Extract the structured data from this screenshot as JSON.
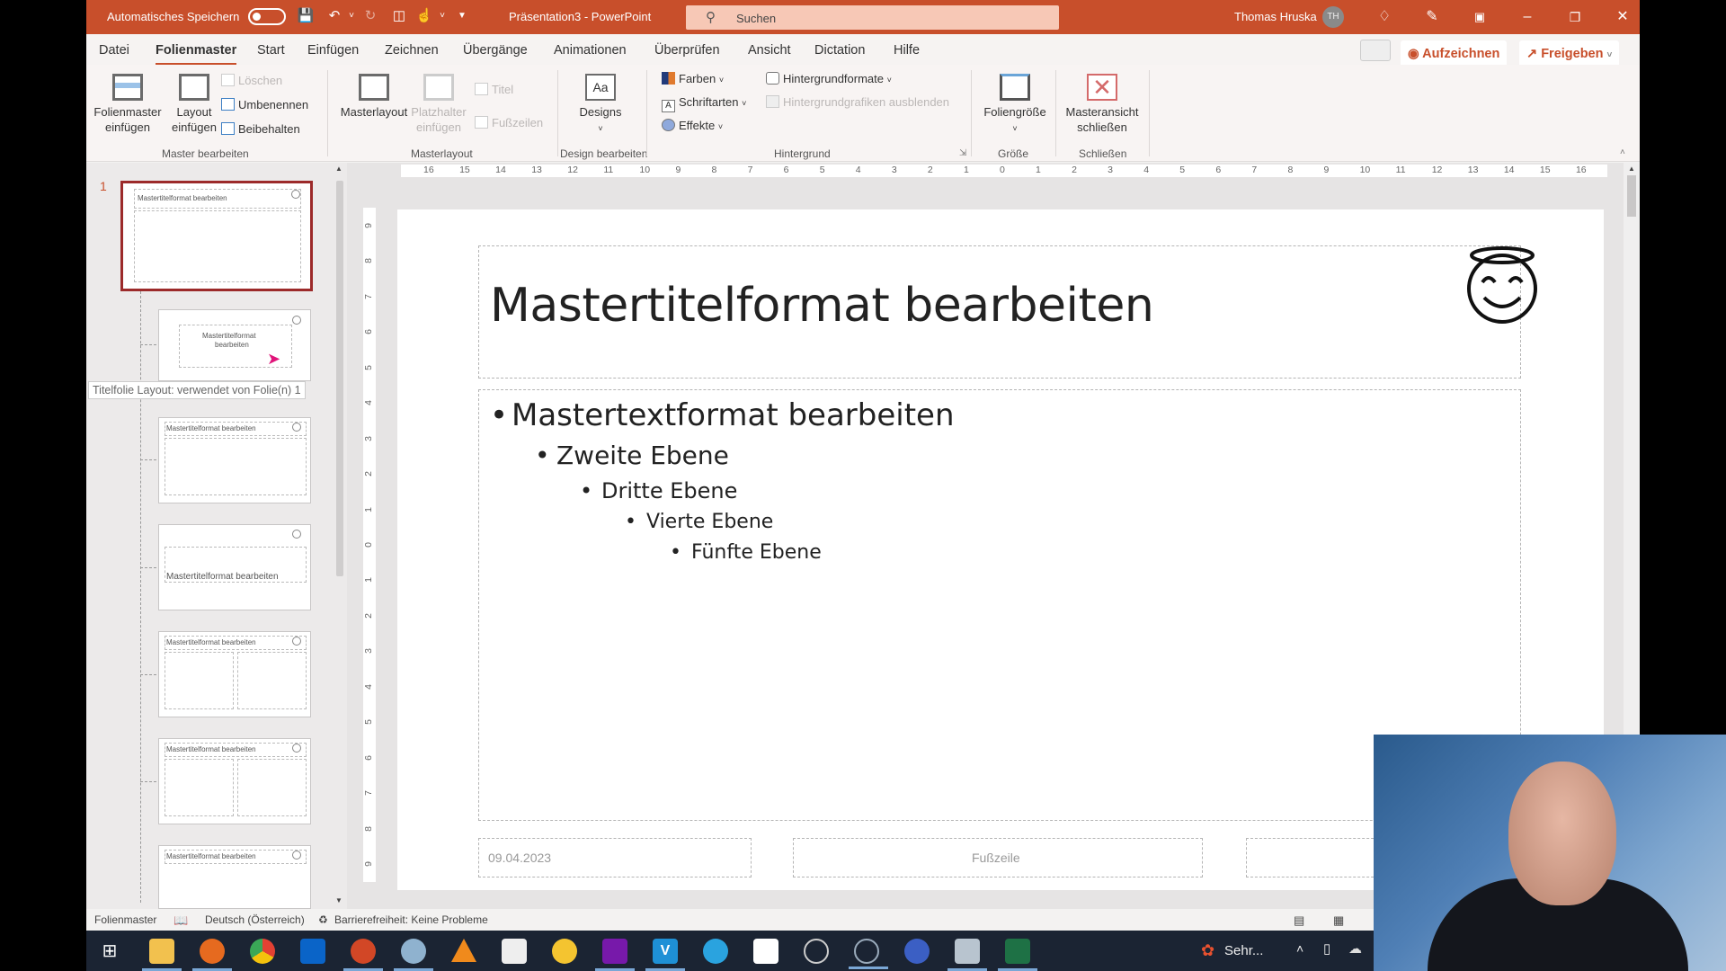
{
  "titlebar": {
    "autosave_label": "Automatisches Speichern",
    "autosave_state": "off",
    "doc_title": "Präsentation3  -  PowerPoint",
    "search_placeholder": "Suchen",
    "user_name": "Thomas Hruska",
    "user_initials": "TH",
    "icons": [
      "save-icon",
      "undo-icon",
      "redo-icon",
      "present-icon",
      "touch-mode-icon",
      "customize-qat-icon",
      "diamond-icon",
      "pen-icon",
      "ribbon-display-icon",
      "minimize-icon",
      "restore-icon",
      "close-icon"
    ]
  },
  "menu": {
    "tabs": [
      "Datei",
      "Folienmaster",
      "Start",
      "Einfügen",
      "Zeichnen",
      "Übergänge",
      "Animationen",
      "Überprüfen",
      "Ansicht",
      "Dictation",
      "Hilfe"
    ],
    "active": "Folienmaster",
    "record_label": "Aufzeichnen",
    "share_label": "Freigeben"
  },
  "ribbon": {
    "groups": {
      "master_edit": "Master bearbeiten",
      "masterlayout": "Masterlayout",
      "design_edit": "Design bearbeiten",
      "background": "Hintergrund",
      "size": "Größe",
      "close": "Schließen"
    },
    "buttons": {
      "insert_master_1": "Folienmaster",
      "insert_master_2": "einfügen",
      "insert_layout_1": "Layout",
      "insert_layout_2": "einfügen",
      "delete": "Löschen",
      "rename": "Umbenennen",
      "preserve": "Beibehalten",
      "masterlayout": "Masterlayout",
      "placeholder_1": "Platzhalter",
      "placeholder_2": "einfügen",
      "title_check": "Titel",
      "footer_check": "Fußzeilen",
      "designs": "Designs",
      "colors": "Farben",
      "fonts": "Schriftarten",
      "effects": "Effekte",
      "bg_formats": "Hintergrundformate",
      "hide_bg": "Hintergrundgrafiken ausblenden",
      "slide_size": "Foliengröße",
      "close_master_1": "Masteransicht",
      "close_master_2": "schließen"
    }
  },
  "thumbnails": {
    "master_number": "1",
    "master_title": "Mastertitelformat bearbeiten",
    "layout_title_2line_a": "Mastertitelformat",
    "layout_title_2line_b": "bearbeiten",
    "tooltip": "Titelfolie Layout: verwendet von Folie(n) 1"
  },
  "ruler": {
    "h": [
      "16",
      "15",
      "14",
      "13",
      "12",
      "11",
      "10",
      "9",
      "8",
      "7",
      "6",
      "5",
      "4",
      "3",
      "2",
      "1",
      "0",
      "1",
      "2",
      "3",
      "4",
      "5",
      "6",
      "7",
      "8",
      "9",
      "10",
      "11",
      "12",
      "13",
      "14",
      "15",
      "16"
    ],
    "v": [
      "9",
      "8",
      "7",
      "6",
      "5",
      "4",
      "3",
      "2",
      "1",
      "0",
      "1",
      "2",
      "3",
      "4",
      "5",
      "6",
      "7",
      "8",
      "9"
    ]
  },
  "slide": {
    "title": "Mastertitelformat bearbeiten",
    "levels": [
      "Mastertextformat bearbeiten",
      "Zweite Ebene",
      "Dritte Ebene",
      "Vierte Ebene",
      "Fünfte Ebene"
    ],
    "date": "09.04.2023",
    "footer": "Fußzeile",
    "icon": "smiling-face-with-halo-icon"
  },
  "status": {
    "view": "Folienmaster",
    "language": "Deutsch (Österreich)",
    "accessibility": "Barrierefreiheit: Keine Probleme"
  },
  "taskbar": {
    "apps": [
      "Windows Start",
      "Explorer",
      "Firefox",
      "Chrome",
      "Outlook",
      "PowerPoint",
      "Paint 3D",
      "VLC",
      "Office",
      "Idea",
      "OneNote",
      "V",
      "Telegram",
      "App",
      "OBS",
      "Record",
      "Elgato",
      "Tablet",
      "Excel"
    ],
    "tray_weather": "Sehr..."
  }
}
